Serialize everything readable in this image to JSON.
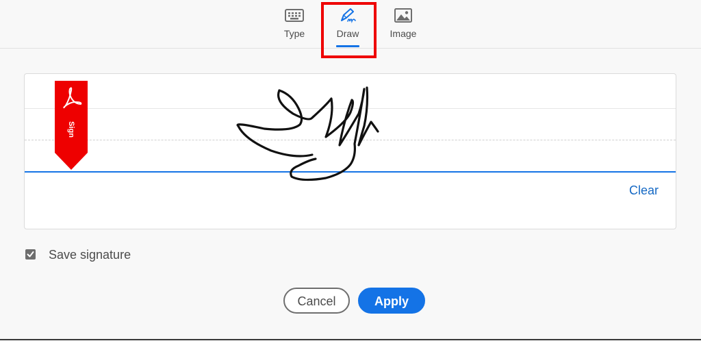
{
  "tabs": [
    {
      "label": "Type",
      "icon": "keyboard-icon"
    },
    {
      "label": "Draw",
      "icon": "pen-draw-icon",
      "active": true
    },
    {
      "label": "Image",
      "icon": "image-icon"
    }
  ],
  "signature_area": {
    "flag_text": "Sign",
    "flag_icon": "adobe-acrobat-logo-icon",
    "clear_label": "Clear"
  },
  "save_signature": {
    "label": "Save signature",
    "checked": true
  },
  "buttons": {
    "cancel_label": "Cancel",
    "apply_label": "Apply"
  },
  "colors": {
    "accent": "#1473e6",
    "flag_red": "#ee0000",
    "highlight_red": "#ee0000"
  }
}
